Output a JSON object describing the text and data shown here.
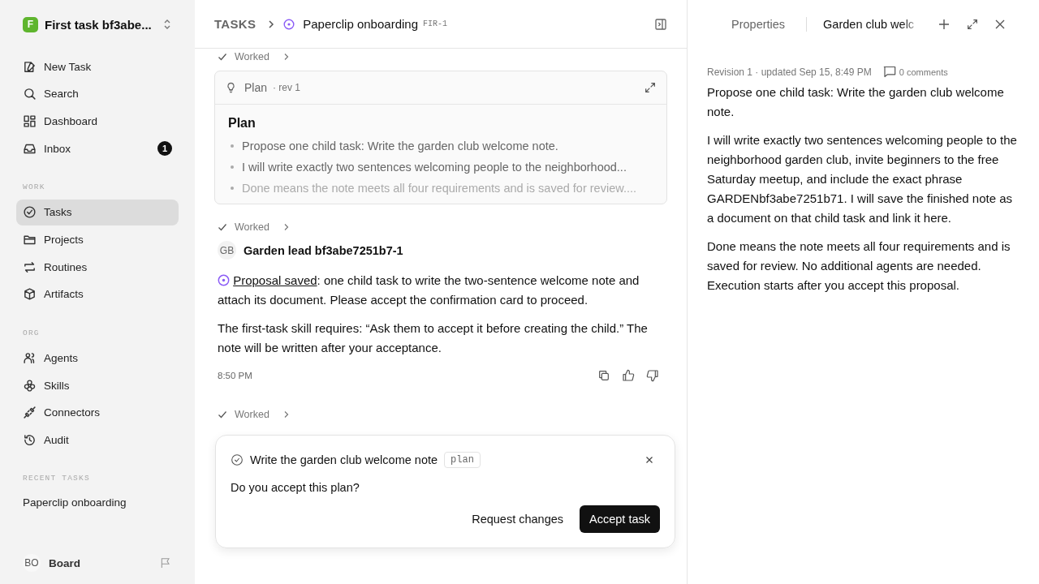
{
  "workspace": {
    "name": "First task bf3abe...",
    "initial": "F"
  },
  "nav": [
    {
      "label": "New Task",
      "selected": false
    },
    {
      "label": "Search",
      "selected": false
    },
    {
      "label": "Dashboard",
      "selected": false
    },
    {
      "label": "Inbox",
      "selected": false,
      "badge": "1"
    }
  ],
  "sections": [
    {
      "title": "WORK",
      "items": [
        {
          "label": "Tasks",
          "selected": true
        },
        {
          "label": "Projects",
          "selected": false
        },
        {
          "label": "Routines",
          "selected": false
        },
        {
          "label": "Artifacts",
          "selected": false
        }
      ]
    },
    {
      "title": "ORG",
      "items": [
        {
          "label": "Agents",
          "selected": false
        },
        {
          "label": "Skills",
          "selected": false
        },
        {
          "label": "Connectors",
          "selected": false
        },
        {
          "label": "Audit",
          "selected": false
        }
      ]
    }
  ],
  "recent": {
    "title": "RECENT TASKS",
    "items": [
      "Paperclip onboarding"
    ]
  },
  "user": {
    "initials": "BO",
    "name": "Board"
  },
  "breadcrumb": {
    "root": "TASKS",
    "title": "Paperclip onboarding",
    "code": "FIR-1"
  },
  "feed": [
    {
      "kind": "worked",
      "label": "Worked"
    },
    {
      "kind": "plan",
      "label": "Plan",
      "rev": "· rev 1",
      "heading": "Plan",
      "bullets": [
        "Propose one child task: Write the garden club welcome note.",
        "I will write exactly two sentences welcoming people to the neighborhood...",
        "Done means the note meets all four requirements and is saved for review...."
      ]
    },
    {
      "kind": "worked",
      "label": "Worked"
    },
    {
      "kind": "message",
      "initials": "GB",
      "author": "Garden lead bf3abe7251b7-1",
      "link": "Proposal saved",
      "text": ": one child task to write the two-sentence welcome note and attach its document. Please accept the confirmation card to proceed.",
      "paragraph": "The first-task skill requires: “Ask them to accept it before creating the child.” The note will be written after your acceptance.",
      "time": "8:50 PM"
    },
    {
      "kind": "worked",
      "label": "Worked"
    }
  ],
  "confirm": {
    "title": "Write the garden club welcome note",
    "tag": "plan",
    "question": "Do you accept this plan?",
    "buttons": [
      "Request changes",
      "Accept task"
    ]
  },
  "panel": {
    "tabs": [
      {
        "label": "Properties",
        "selected": false
      },
      {
        "label": "Garden club welc",
        "selected": true
      }
    ],
    "meta": "Revision 1 · updated Sep 15, 8:49 PM",
    "comments": "0 comments",
    "paragraphs": [
      "Propose one child task: Write the garden club welcome note.",
      "I will write exactly two sentences welcoming people to the neighborhood garden club, invite beginners to the free Saturday meetup, and include the exact phrase GARDENbf3abe7251b71. I will save the finished note as a document on that child task and link it here.",
      "Done means the note meets all four requirements and is saved for review. No additional agents are needed. Execution starts after you accept this proposal."
    ]
  }
}
